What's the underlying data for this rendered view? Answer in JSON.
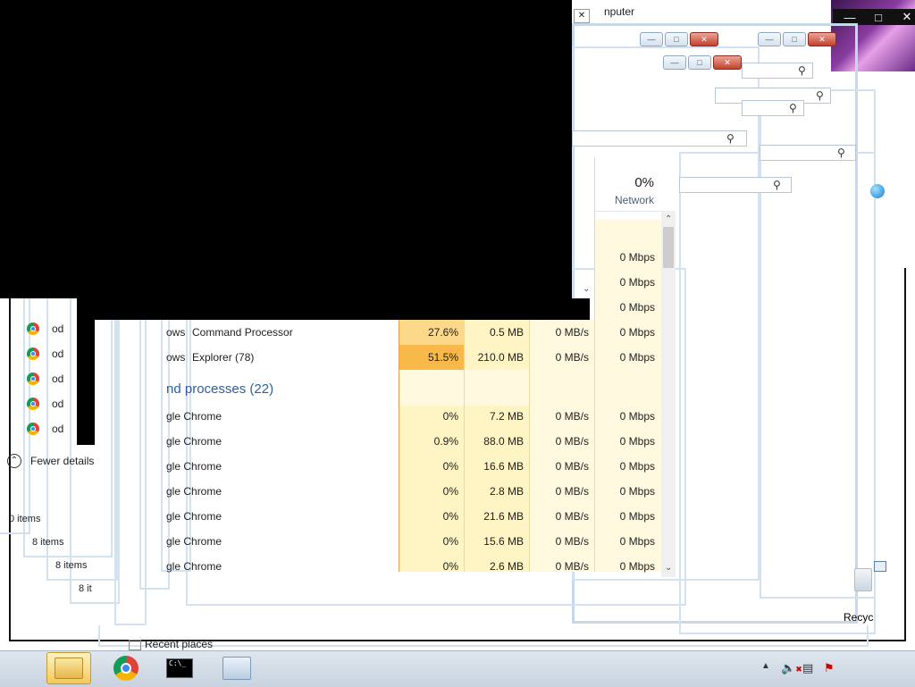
{
  "window_title_partial": "nputer",
  "taskmanager": {
    "network_header": {
      "pct": "0%",
      "label": "Network"
    },
    "rows_top_net": [
      "0 Mbps",
      "0 Mbps",
      "0 Mbps"
    ],
    "apps": [
      {
        "name": "Command Processor",
        "prefix": "ows",
        "cpu": "27.6%",
        "mem": "0.5 MB",
        "disk": "0 MB/s",
        "net": "0 Mbps"
      },
      {
        "name": "Explorer (78)",
        "prefix": "ows",
        "cpu": "51.5%",
        "mem": "210.0 MB",
        "disk": "0 MB/s",
        "net": "0 Mbps"
      }
    ],
    "group_label": "nd processes (22)",
    "bg": [
      {
        "name": "gle Chrome",
        "cpu": "0%",
        "mem": "7.2 MB",
        "disk": "0 MB/s",
        "net": "0 Mbps"
      },
      {
        "name": "gle Chrome",
        "cpu": "0.9%",
        "mem": "88.0 MB",
        "disk": "0 MB/s",
        "net": "0 Mbps"
      },
      {
        "name": "gle Chrome",
        "cpu": "0%",
        "mem": "16.6 MB",
        "disk": "0 MB/s",
        "net": "0 Mbps"
      },
      {
        "name": "gle Chrome",
        "cpu": "0%",
        "mem": "2.8 MB",
        "disk": "0 MB/s",
        "net": "0 Mbps"
      },
      {
        "name": "gle Chrome",
        "cpu": "0%",
        "mem": "21.6 MB",
        "disk": "0 MB/s",
        "net": "0 Mbps"
      },
      {
        "name": "gle Chrome",
        "cpu": "0%",
        "mem": "15.6 MB",
        "disk": "0 MB/s",
        "net": "0 Mbps"
      },
      {
        "name": "gle Chrome",
        "cpu": "0%",
        "mem": "2.6 MB",
        "disk": "0 MB/s",
        "net": "0 Mbps"
      }
    ],
    "fewer_details": "Fewer details"
  },
  "explorer": {
    "items_0": "0 items",
    "items_8a": "8 items",
    "items_8b": "8 items",
    "items_8c": "8 it",
    "chrome_row_label": "od",
    "recent_places": "Recent places"
  },
  "desktop": {
    "recycle_label": "Recyc"
  },
  "colors": {
    "cpu_hot": "#f8b94a",
    "cpu_warm": "#fbd88a",
    "heat_light": "#fff4c4",
    "heat_lighter": "#fff9e0",
    "group_blue": "#2a5fa8"
  },
  "taskbar": {
    "buttons": [
      "file-explorer-icon",
      "chrome-icon",
      "cmd-icon",
      "task-manager-icon"
    ],
    "tray": [
      "show-hidden-icons",
      "speaker-muted-icon",
      "network-icon",
      "action-center-icon"
    ]
  }
}
